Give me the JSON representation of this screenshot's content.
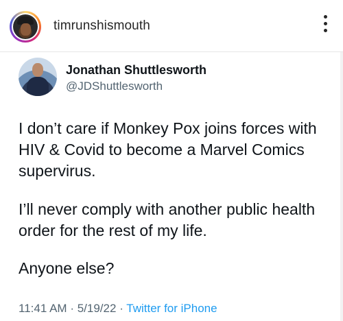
{
  "post": {
    "username": "timrunshismouth",
    "more_icon": "more-vertical-icon"
  },
  "tweet": {
    "display_name": "Jonathan Shuttlesworth",
    "handle": "@JDShuttlesworth",
    "paragraphs": [
      "I don’t care if Monkey Pox joins forces with HIV & Covid to become a Marvel Comics supervirus.",
      "I’ll never comply with another public health order for the rest of my life.",
      "Anyone else?"
    ],
    "time": "11:41 AM",
    "separator": "·",
    "date": "5/19/22",
    "source": "Twitter for iPhone"
  },
  "colors": {
    "text_primary": "#0f1419",
    "text_secondary": "#536471",
    "link": "#1d9bf0"
  }
}
